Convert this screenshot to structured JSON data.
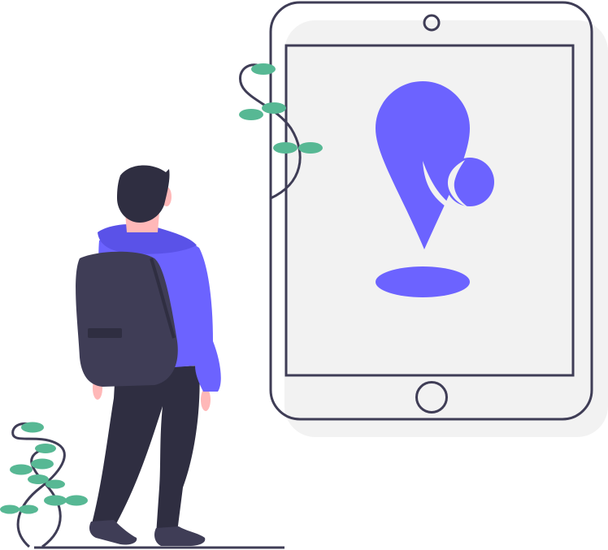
{
  "illustration": {
    "subject": "person-with-backpack-looking-at-tablet-location-pin",
    "colors": {
      "accent": "#6c63ff",
      "outline": "#3f3d56",
      "screen_fill": "#f2f2f2",
      "leaf": "#57b894",
      "skin": "#ffb8b8",
      "hair": "#2f2e41",
      "pants": "#2f2e41",
      "backpack": "#3f3d56"
    },
    "icons": [
      "tablet-icon",
      "location-pin-icon",
      "map-shadow-icon",
      "plant-icon"
    ]
  }
}
